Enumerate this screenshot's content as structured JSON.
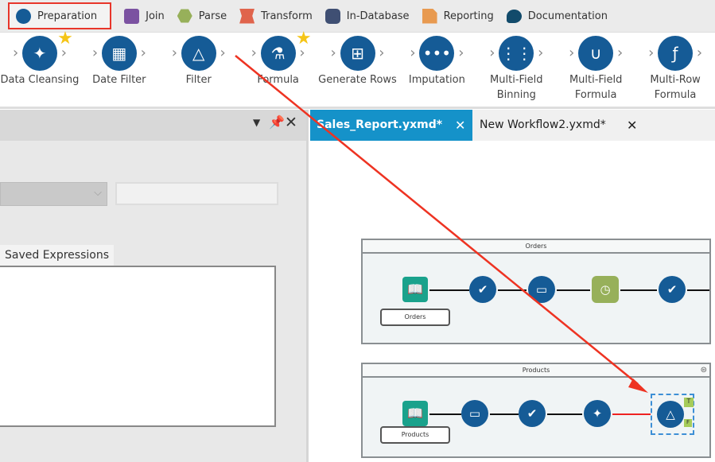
{
  "categories": [
    {
      "label": "Preparation",
      "icon": "circle-icon",
      "color": "#155b96",
      "selected": true
    },
    {
      "label": "Join",
      "icon": "square-icon",
      "color": "#7b52a1"
    },
    {
      "label": "Parse",
      "icon": "hexagon-icon",
      "color": "#97b05a"
    },
    {
      "label": "Transform",
      "icon": "ribbon-icon",
      "color": "#e0644c"
    },
    {
      "label": "In-Database",
      "icon": "database-icon",
      "color": "#3f4f73"
    },
    {
      "label": "Reporting",
      "icon": "document-icon",
      "color": "#e89a50"
    },
    {
      "label": "Documentation",
      "icon": "speech-bubble-icon",
      "color": "#124b6b"
    }
  ],
  "tools": [
    {
      "label": "Data Cleansing",
      "icon": "data-cleansing-icon",
      "favorite": true
    },
    {
      "label": "Date Filter",
      "icon": "date-filter-icon"
    },
    {
      "label": "Filter",
      "icon": "filter-icon"
    },
    {
      "label": "Formula",
      "icon": "formula-icon",
      "favorite": true
    },
    {
      "label": "Generate Rows",
      "icon": "generate-rows-icon"
    },
    {
      "label": "Imputation",
      "icon": "imputation-icon"
    },
    {
      "label": "Multi-Field Binning",
      "icon": "multi-field-binning-icon"
    },
    {
      "label": "Multi-Field Formula",
      "icon": "multi-field-formula-icon"
    },
    {
      "label": "Multi-Row Formula",
      "icon": "multi-row-formula-icon"
    }
  ],
  "left_panel": {
    "tab_label": "Saved Expressions",
    "dropdown_value": "",
    "text_value": ""
  },
  "tabs": [
    {
      "label": "Sales_Report.yxmd*",
      "active": true
    },
    {
      "label": "New Workflow2.yxmd*",
      "active": false
    }
  ],
  "containers": {
    "orders": {
      "title": "Orders",
      "input_label": "Orders"
    },
    "products": {
      "title": "Products",
      "input_label": "Products"
    }
  },
  "filter_anchors": {
    "true": "T",
    "false": "F"
  },
  "annotation_color": "#ee3322"
}
